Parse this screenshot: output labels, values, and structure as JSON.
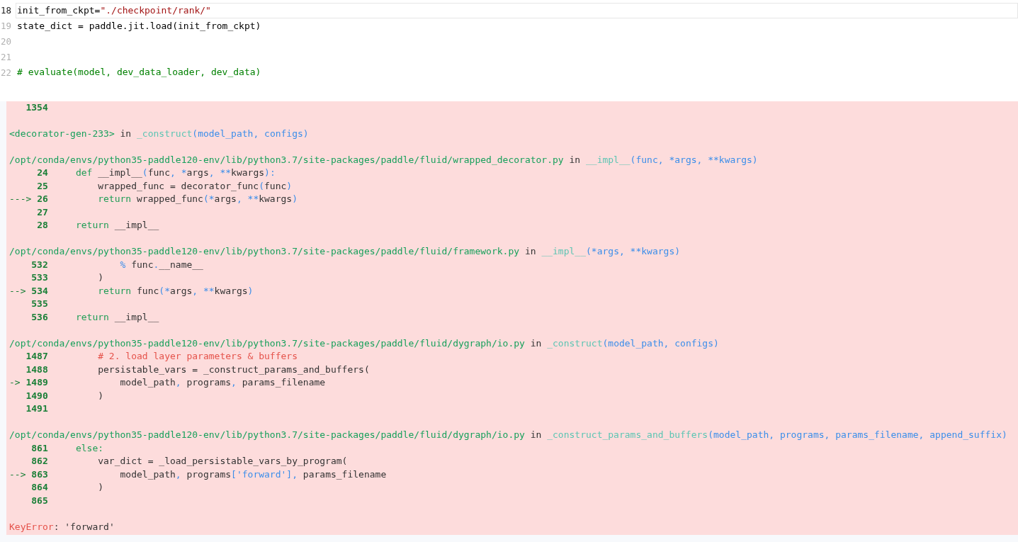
{
  "code_cell": {
    "lines": [
      {
        "number": "18",
        "selected": true,
        "tokens": [
          {
            "kind": "plain",
            "text": "init_from_ckpt="
          },
          {
            "kind": "string",
            "text": "\"./checkpoint/rank/\""
          }
        ]
      },
      {
        "number": "19",
        "selected": false,
        "tokens": [
          {
            "kind": "plain",
            "text": "state_dict = paddle.jit.load(init_from_ckpt)"
          }
        ]
      },
      {
        "number": "20",
        "selected": false
      },
      {
        "number": "21",
        "selected": false
      },
      {
        "number": "22",
        "selected": false,
        "tokens": [
          {
            "kind": "comment",
            "text": "# evaluate(model, dev_data_loader, dev_data)"
          }
        ]
      }
    ]
  },
  "traceback": {
    "frames": [
      {
        "lines": [
          {
            "number": "1354"
          }
        ]
      },
      {
        "header": [
          {
            "kind": "filename",
            "text": "<decorator-gen-233>"
          },
          {
            "kind": "plain",
            "text": " in "
          },
          {
            "kind": "function",
            "text": "_construct"
          },
          {
            "kind": "params",
            "text": "(model_path, configs)"
          }
        ]
      },
      {
        "header": [
          {
            "kind": "filename",
            "text": "/opt/conda/envs/python35-paddle120-env/lib/python3.7/site-packages/paddle/fluid/wrapped_decorator.py"
          },
          {
            "kind": "plain",
            "text": " in "
          },
          {
            "kind": "function",
            "text": "__impl__"
          },
          {
            "kind": "params",
            "text": "(func, *args, **kwargs)"
          }
        ],
        "lines": [
          {
            "number": "24",
            "tokens": [
              {
                "kind": "keyword",
                "text": "def"
              },
              {
                "kind": "plain",
                "text": " __impl__"
              },
              {
                "kind": "operator",
                "text": "("
              },
              {
                "kind": "plain",
                "text": "func"
              },
              {
                "kind": "operator",
                "text": ", *"
              },
              {
                "kind": "plain",
                "text": "args"
              },
              {
                "kind": "operator",
                "text": ", **"
              },
              {
                "kind": "plain",
                "text": "kwargs"
              },
              {
                "kind": "operator",
                "text": "):"
              }
            ]
          },
          {
            "number": "25",
            "tokens": [
              {
                "kind": "plain",
                "text": "    wrapped_func = decorator_func"
              },
              {
                "kind": "operator",
                "text": "("
              },
              {
                "kind": "plain",
                "text": "func"
              },
              {
                "kind": "operator",
                "text": ")"
              }
            ]
          },
          {
            "marker": "--->",
            "number": "26",
            "tokens": [
              {
                "kind": "keyword",
                "text": "    return"
              },
              {
                "kind": "plain",
                "text": " wrapped_func"
              },
              {
                "kind": "operator",
                "text": "(*"
              },
              {
                "kind": "plain",
                "text": "args"
              },
              {
                "kind": "operator",
                "text": ", **"
              },
              {
                "kind": "plain",
                "text": "kwargs"
              },
              {
                "kind": "operator",
                "text": ")"
              }
            ]
          },
          {
            "number": "27"
          },
          {
            "number": "28",
            "tokens": [
              {
                "kind": "keyword",
                "text": "return"
              },
              {
                "kind": "plain",
                "text": " __impl__"
              }
            ]
          }
        ]
      },
      {
        "header": [
          {
            "kind": "filename",
            "text": "/opt/conda/envs/python35-paddle120-env/lib/python3.7/site-packages/paddle/fluid/framework.py"
          },
          {
            "kind": "plain",
            "text": " in "
          },
          {
            "kind": "function",
            "text": "__impl__"
          },
          {
            "kind": "params",
            "text": "(*args, **kwargs)"
          }
        ],
        "lines": [
          {
            "number": "532",
            "tokens": [
              {
                "kind": "operator",
                "text": "        % "
              },
              {
                "kind": "plain",
                "text": "func"
              },
              {
                "kind": "operator",
                "text": "."
              },
              {
                "kind": "plain",
                "text": "__name__"
              }
            ]
          },
          {
            "number": "533",
            "tokens": [
              {
                "kind": "plain",
                "text": "    )"
              }
            ]
          },
          {
            "marker": "-->",
            "number": "534",
            "tokens": [
              {
                "kind": "keyword",
                "text": "    return"
              },
              {
                "kind": "plain",
                "text": " func"
              },
              {
                "kind": "operator",
                "text": "(*"
              },
              {
                "kind": "plain",
                "text": "args"
              },
              {
                "kind": "operator",
                "text": ", **"
              },
              {
                "kind": "plain",
                "text": "kwargs"
              },
              {
                "kind": "operator",
                "text": ")"
              }
            ]
          },
          {
            "number": "535"
          },
          {
            "number": "536",
            "tokens": [
              {
                "kind": "keyword",
                "text": "return"
              },
              {
                "kind": "plain",
                "text": " __impl__"
              }
            ]
          }
        ]
      },
      {
        "header": [
          {
            "kind": "filename",
            "text": "/opt/conda/envs/python35-paddle120-env/lib/python3.7/site-packages/paddle/fluid/dygraph/io.py"
          },
          {
            "kind": "plain",
            "text": " in "
          },
          {
            "kind": "function",
            "text": "_construct"
          },
          {
            "kind": "params",
            "text": "(model_path, configs)"
          }
        ],
        "lines": [
          {
            "number": "1487",
            "tokens": [
              {
                "kind": "comment",
                "text": "    # 2. load layer parameters & buffers"
              }
            ]
          },
          {
            "number": "1488",
            "tokens": [
              {
                "kind": "plain",
                "text": "    persistable_vars = _construct_params_and_buffers("
              }
            ]
          },
          {
            "marker": "->",
            "number": "1489",
            "tokens": [
              {
                "kind": "plain",
                "text": "        model_path"
              },
              {
                "kind": "operator",
                "text": ","
              },
              {
                "kind": "plain",
                "text": " programs"
              },
              {
                "kind": "operator",
                "text": ","
              },
              {
                "kind": "plain",
                "text": " params_filename"
              }
            ]
          },
          {
            "number": "1490",
            "tokens": [
              {
                "kind": "plain",
                "text": "    )"
              }
            ]
          },
          {
            "number": "1491"
          }
        ]
      },
      {
        "header": [
          {
            "kind": "filename",
            "text": "/opt/conda/envs/python35-paddle120-env/lib/python3.7/site-packages/paddle/fluid/dygraph/io.py"
          },
          {
            "kind": "plain",
            "text": " in "
          },
          {
            "kind": "function",
            "text": "_construct_params_and_buffers"
          },
          {
            "kind": "params",
            "text": "(model_path, programs, params_filename, append_suffix)"
          }
        ],
        "lines": [
          {
            "number": "861",
            "tokens": [
              {
                "kind": "keyword",
                "text": "else:"
              }
            ]
          },
          {
            "number": "862",
            "tokens": [
              {
                "kind": "plain",
                "text": "    var_dict = _load_persistable_vars_by_program("
              }
            ]
          },
          {
            "marker": "-->",
            "number": "863",
            "tokens": [
              {
                "kind": "plain",
                "text": "        model_path"
              },
              {
                "kind": "operator",
                "text": ","
              },
              {
                "kind": "plain",
                "text": " programs"
              },
              {
                "kind": "operator",
                "text": "['forward'],"
              },
              {
                "kind": "plain",
                "text": " params_filename"
              }
            ]
          },
          {
            "number": "864",
            "tokens": [
              {
                "kind": "plain",
                "text": "    )"
              }
            ]
          },
          {
            "number": "865"
          }
        ]
      }
    ],
    "error": [
      {
        "kind": "exception",
        "text": "KeyError"
      },
      {
        "kind": "plain",
        "text": ": 'forward'"
      }
    ]
  }
}
